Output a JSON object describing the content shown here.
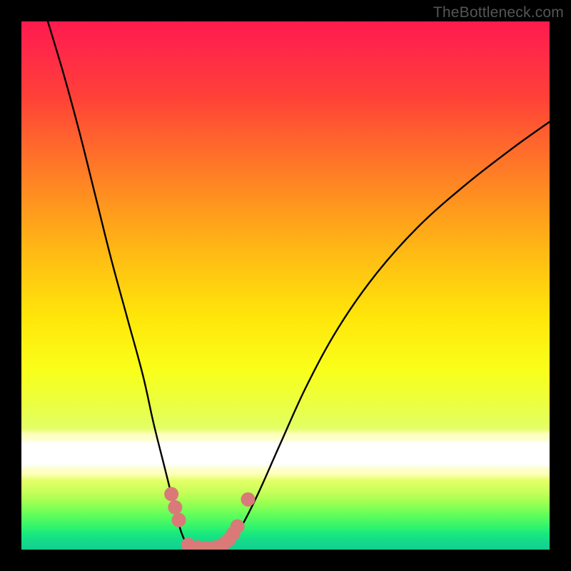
{
  "watermark": "TheBottleneck.com",
  "colors": {
    "frame": "#000000",
    "curve": "#000000",
    "marker": "#d97a78",
    "curve_width": 2.4,
    "marker_radius": 10
  },
  "chart_data": {
    "type": "line",
    "title": "",
    "xlabel": "",
    "ylabel": "",
    "xlim": [
      0,
      100
    ],
    "ylim": [
      0,
      100
    ],
    "grid": false,
    "legend": false,
    "annotations": [],
    "series": [
      {
        "name": "left-branch",
        "x": [
          5,
          8,
          11,
          14,
          17,
          20,
          23,
          25,
          27,
          28.5,
          29.5,
          30.2,
          31,
          31.5
        ],
        "y": [
          100,
          90,
          79,
          67,
          55,
          44,
          33,
          24,
          16,
          10,
          6,
          3.5,
          1.5,
          0.5
        ]
      },
      {
        "name": "valley-floor",
        "x": [
          31.5,
          33,
          35,
          37,
          38.5
        ],
        "y": [
          0.5,
          0.2,
          0.15,
          0.2,
          0.5
        ]
      },
      {
        "name": "right-branch",
        "x": [
          38.5,
          40,
          42,
          45,
          49,
          54,
          60,
          67,
          75,
          84,
          93,
          100
        ],
        "y": [
          0.5,
          2,
          5,
          11,
          20,
          31,
          42,
          52,
          61,
          69,
          76,
          81
        ]
      }
    ],
    "markers": [
      {
        "x": 28.4,
        "y": 10.5
      },
      {
        "x": 29.1,
        "y": 8.0
      },
      {
        "x": 29.8,
        "y": 5.6
      },
      {
        "x": 31.6,
        "y": 0.9
      },
      {
        "x": 33.3,
        "y": 0.4
      },
      {
        "x": 35.0,
        "y": 0.3
      },
      {
        "x": 36.7,
        "y": 0.4
      },
      {
        "x": 38.1,
        "y": 0.9
      },
      {
        "x": 39.2,
        "y": 1.8
      },
      {
        "x": 40.1,
        "y": 3.0
      },
      {
        "x": 40.9,
        "y": 4.4
      },
      {
        "x": 42.9,
        "y": 9.5
      }
    ]
  }
}
